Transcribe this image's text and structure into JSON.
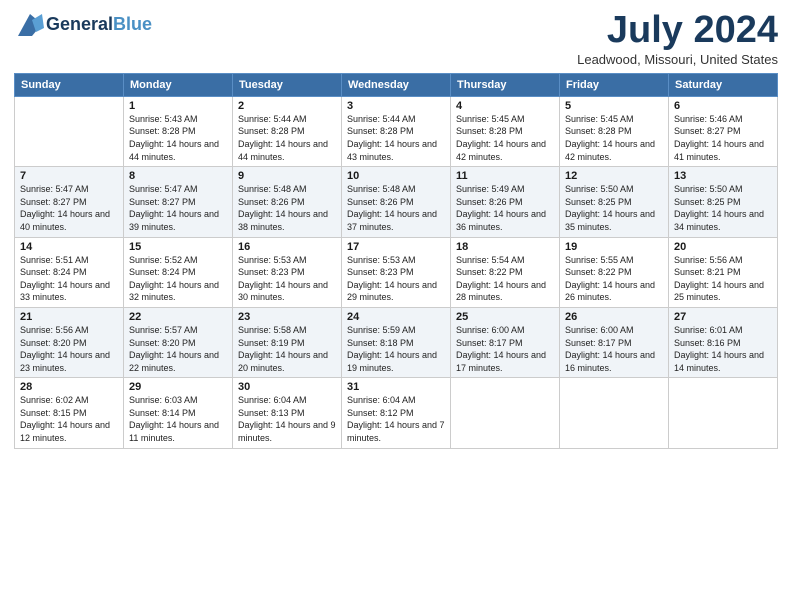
{
  "header": {
    "logo_general": "General",
    "logo_blue": "Blue",
    "month_title": "July 2024",
    "location": "Leadwood, Missouri, United States"
  },
  "weekdays": [
    "Sunday",
    "Monday",
    "Tuesday",
    "Wednesday",
    "Thursday",
    "Friday",
    "Saturday"
  ],
  "weeks": [
    [
      {
        "day": "",
        "sunrise": "",
        "sunset": "",
        "daylight": ""
      },
      {
        "day": "1",
        "sunrise": "Sunrise: 5:43 AM",
        "sunset": "Sunset: 8:28 PM",
        "daylight": "Daylight: 14 hours and 44 minutes."
      },
      {
        "day": "2",
        "sunrise": "Sunrise: 5:44 AM",
        "sunset": "Sunset: 8:28 PM",
        "daylight": "Daylight: 14 hours and 44 minutes."
      },
      {
        "day": "3",
        "sunrise": "Sunrise: 5:44 AM",
        "sunset": "Sunset: 8:28 PM",
        "daylight": "Daylight: 14 hours and 43 minutes."
      },
      {
        "day": "4",
        "sunrise": "Sunrise: 5:45 AM",
        "sunset": "Sunset: 8:28 PM",
        "daylight": "Daylight: 14 hours and 42 minutes."
      },
      {
        "day": "5",
        "sunrise": "Sunrise: 5:45 AM",
        "sunset": "Sunset: 8:28 PM",
        "daylight": "Daylight: 14 hours and 42 minutes."
      },
      {
        "day": "6",
        "sunrise": "Sunrise: 5:46 AM",
        "sunset": "Sunset: 8:27 PM",
        "daylight": "Daylight: 14 hours and 41 minutes."
      }
    ],
    [
      {
        "day": "7",
        "sunrise": "Sunrise: 5:47 AM",
        "sunset": "Sunset: 8:27 PM",
        "daylight": "Daylight: 14 hours and 40 minutes."
      },
      {
        "day": "8",
        "sunrise": "Sunrise: 5:47 AM",
        "sunset": "Sunset: 8:27 PM",
        "daylight": "Daylight: 14 hours and 39 minutes."
      },
      {
        "day": "9",
        "sunrise": "Sunrise: 5:48 AM",
        "sunset": "Sunset: 8:26 PM",
        "daylight": "Daylight: 14 hours and 38 minutes."
      },
      {
        "day": "10",
        "sunrise": "Sunrise: 5:48 AM",
        "sunset": "Sunset: 8:26 PM",
        "daylight": "Daylight: 14 hours and 37 minutes."
      },
      {
        "day": "11",
        "sunrise": "Sunrise: 5:49 AM",
        "sunset": "Sunset: 8:26 PM",
        "daylight": "Daylight: 14 hours and 36 minutes."
      },
      {
        "day": "12",
        "sunrise": "Sunrise: 5:50 AM",
        "sunset": "Sunset: 8:25 PM",
        "daylight": "Daylight: 14 hours and 35 minutes."
      },
      {
        "day": "13",
        "sunrise": "Sunrise: 5:50 AM",
        "sunset": "Sunset: 8:25 PM",
        "daylight": "Daylight: 14 hours and 34 minutes."
      }
    ],
    [
      {
        "day": "14",
        "sunrise": "Sunrise: 5:51 AM",
        "sunset": "Sunset: 8:24 PM",
        "daylight": "Daylight: 14 hours and 33 minutes."
      },
      {
        "day": "15",
        "sunrise": "Sunrise: 5:52 AM",
        "sunset": "Sunset: 8:24 PM",
        "daylight": "Daylight: 14 hours and 32 minutes."
      },
      {
        "day": "16",
        "sunrise": "Sunrise: 5:53 AM",
        "sunset": "Sunset: 8:23 PM",
        "daylight": "Daylight: 14 hours and 30 minutes."
      },
      {
        "day": "17",
        "sunrise": "Sunrise: 5:53 AM",
        "sunset": "Sunset: 8:23 PM",
        "daylight": "Daylight: 14 hours and 29 minutes."
      },
      {
        "day": "18",
        "sunrise": "Sunrise: 5:54 AM",
        "sunset": "Sunset: 8:22 PM",
        "daylight": "Daylight: 14 hours and 28 minutes."
      },
      {
        "day": "19",
        "sunrise": "Sunrise: 5:55 AM",
        "sunset": "Sunset: 8:22 PM",
        "daylight": "Daylight: 14 hours and 26 minutes."
      },
      {
        "day": "20",
        "sunrise": "Sunrise: 5:56 AM",
        "sunset": "Sunset: 8:21 PM",
        "daylight": "Daylight: 14 hours and 25 minutes."
      }
    ],
    [
      {
        "day": "21",
        "sunrise": "Sunrise: 5:56 AM",
        "sunset": "Sunset: 8:20 PM",
        "daylight": "Daylight: 14 hours and 23 minutes."
      },
      {
        "day": "22",
        "sunrise": "Sunrise: 5:57 AM",
        "sunset": "Sunset: 8:20 PM",
        "daylight": "Daylight: 14 hours and 22 minutes."
      },
      {
        "day": "23",
        "sunrise": "Sunrise: 5:58 AM",
        "sunset": "Sunset: 8:19 PM",
        "daylight": "Daylight: 14 hours and 20 minutes."
      },
      {
        "day": "24",
        "sunrise": "Sunrise: 5:59 AM",
        "sunset": "Sunset: 8:18 PM",
        "daylight": "Daylight: 14 hours and 19 minutes."
      },
      {
        "day": "25",
        "sunrise": "Sunrise: 6:00 AM",
        "sunset": "Sunset: 8:17 PM",
        "daylight": "Daylight: 14 hours and 17 minutes."
      },
      {
        "day": "26",
        "sunrise": "Sunrise: 6:00 AM",
        "sunset": "Sunset: 8:17 PM",
        "daylight": "Daylight: 14 hours and 16 minutes."
      },
      {
        "day": "27",
        "sunrise": "Sunrise: 6:01 AM",
        "sunset": "Sunset: 8:16 PM",
        "daylight": "Daylight: 14 hours and 14 minutes."
      }
    ],
    [
      {
        "day": "28",
        "sunrise": "Sunrise: 6:02 AM",
        "sunset": "Sunset: 8:15 PM",
        "daylight": "Daylight: 14 hours and 12 minutes."
      },
      {
        "day": "29",
        "sunrise": "Sunrise: 6:03 AM",
        "sunset": "Sunset: 8:14 PM",
        "daylight": "Daylight: 14 hours and 11 minutes."
      },
      {
        "day": "30",
        "sunrise": "Sunrise: 6:04 AM",
        "sunset": "Sunset: 8:13 PM",
        "daylight": "Daylight: 14 hours and 9 minutes."
      },
      {
        "day": "31",
        "sunrise": "Sunrise: 6:04 AM",
        "sunset": "Sunset: 8:12 PM",
        "daylight": "Daylight: 14 hours and 7 minutes."
      },
      {
        "day": "",
        "sunrise": "",
        "sunset": "",
        "daylight": ""
      },
      {
        "day": "",
        "sunrise": "",
        "sunset": "",
        "daylight": ""
      },
      {
        "day": "",
        "sunrise": "",
        "sunset": "",
        "daylight": ""
      }
    ]
  ]
}
